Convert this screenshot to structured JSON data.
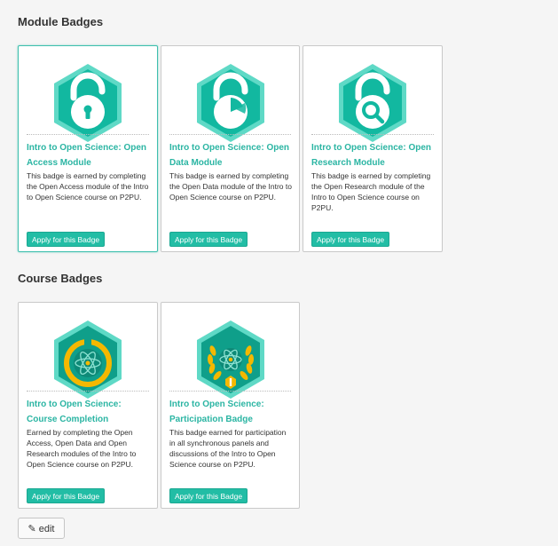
{
  "module_section": {
    "title": "Module Badges",
    "badges": [
      {
        "icon": "open-access-lock-icon",
        "title": "Intro to Open Science: Open Access Module",
        "description": "This badge is earned by completing the Open Access module of the Intro to Open Science course on P2PU.",
        "button": "Apply for this Badge"
      },
      {
        "icon": "open-data-lock-icon",
        "title": "Intro to Open Science: Open Data Module",
        "description": "This badge is earned by completing the Open Data module of the Intro to Open Science course on P2PU.",
        "button": "Apply for this Badge"
      },
      {
        "icon": "open-research-lock-icon",
        "title": "Intro to Open Science: Open Research Module",
        "description": "This badge is earned by completing the Open Research module of the Intro to Open Science course on P2PU.",
        "button": "Apply for this Badge"
      }
    ]
  },
  "course_section": {
    "title": "Course Badges",
    "badges": [
      {
        "icon": "course-completion-atom-icon",
        "title": "Intro to Open Science: Course Completion",
        "description": "Earned by completing the Open Access, Open Data and Open Research modules of the Intro to Open Science course on P2PU.",
        "button": "Apply for this Badge"
      },
      {
        "icon": "participation-laurel-atom-icon",
        "title": "Intro to Open Science: Participation Badge",
        "description": "This badge earned for participation in all synchronous panels and discussions of the Intro to Open Science course on P2PU.",
        "button": "Apply for this Badge"
      }
    ]
  },
  "edit_button": {
    "icon": "edit-icon",
    "label": "edit"
  },
  "colors": {
    "accent": "#22bda5",
    "teal_dark": "#0f9f8a",
    "gold": "#f5b800"
  }
}
